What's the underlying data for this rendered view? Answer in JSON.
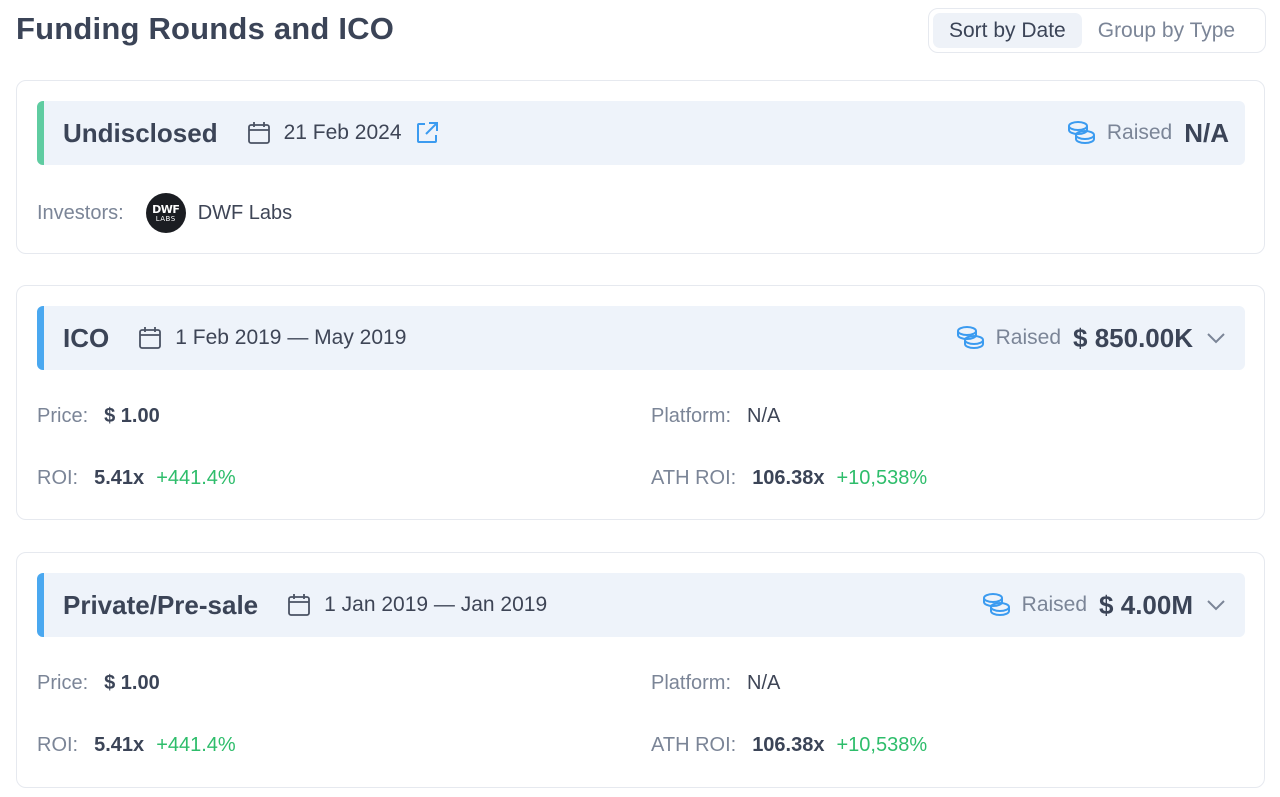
{
  "page": {
    "title": "Funding Rounds and ICO"
  },
  "sort_toggle": {
    "options": [
      "Sort by Date",
      "Group by Type"
    ],
    "active": "Sort by Date"
  },
  "colors": {
    "accent_green": "#5fcca1",
    "accent_blue": "#4aa8f0",
    "positive": "#2ebd6b",
    "icon_blue": "#3b9bf0"
  },
  "rounds": [
    {
      "type": "Undisclosed",
      "date": "21 Feb 2024",
      "raised_label": "Raised",
      "raised_value": "N/A",
      "icons": [
        "calendar-icon",
        "external-link-icon",
        "coins-icon"
      ],
      "investors_label": "Investors:",
      "investor": {
        "name": "DWF Labs",
        "logo_text_1": "DWF",
        "logo_text_2": "LABS"
      }
    },
    {
      "type": "ICO",
      "date": "1 Feb 2019 — May 2019",
      "raised_label": "Raised",
      "raised_value": "$ 850.00K",
      "icons": [
        "calendar-icon",
        "coins-icon",
        "chevron-down-icon"
      ],
      "price_label": "Price:",
      "price": "$ 1.00",
      "platform_label": "Platform:",
      "platform": "N/A",
      "roi_label": "ROI:",
      "roi": "5.41x",
      "roi_pct": "+441.4%",
      "ath_roi_label": "ATH ROI:",
      "ath_roi": "106.38x",
      "ath_roi_pct": "+10,538%"
    },
    {
      "type": "Private/Pre-sale",
      "date": "1 Jan 2019 — Jan 2019",
      "raised_label": "Raised",
      "raised_value": "$ 4.00M",
      "icons": [
        "calendar-icon",
        "coins-icon",
        "chevron-down-icon"
      ],
      "price_label": "Price:",
      "price": "$ 1.00",
      "platform_label": "Platform:",
      "platform": "N/A",
      "roi_label": "ROI:",
      "roi": "5.41x",
      "roi_pct": "+441.4%",
      "ath_roi_label": "ATH ROI:",
      "ath_roi": "106.38x",
      "ath_roi_pct": "+10,538%"
    }
  ]
}
